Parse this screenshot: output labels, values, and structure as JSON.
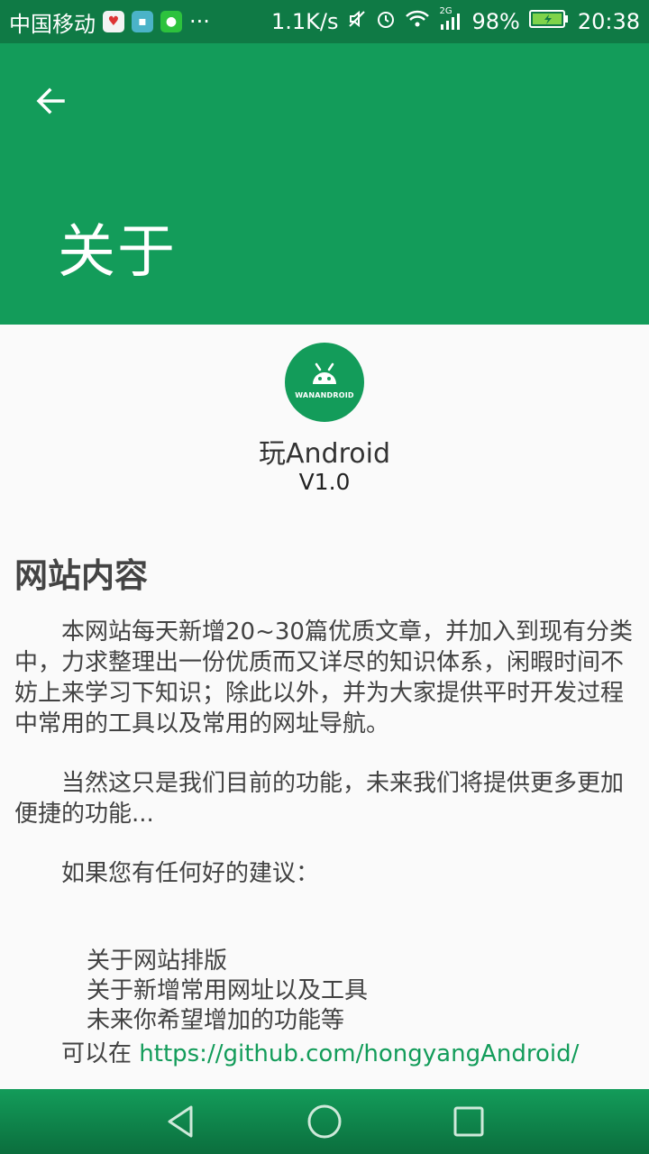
{
  "status": {
    "carrier": "中国移动",
    "more": "···",
    "speed": "1.1K/s",
    "network": "2G",
    "battery": "98%",
    "time": "20:38"
  },
  "appbar": {
    "title": "关于"
  },
  "about": {
    "logo_text": "WANANDROID",
    "app_name": "玩Android",
    "version": "V1.0"
  },
  "section": {
    "heading": "网站内容",
    "para1": "　　本网站每天新增20~30篇优质文章，并加入到现有分类中，力求整理出一份优质而又详尽的知识体系，闲暇时间不妨上来学习下知识；除此以外，并为大家提供平时开发过程中常用的工具以及常用的网址导航。",
    "para2": "　　当然这只是我们目前的功能，未来我们将提供更多更加便捷的功能...",
    "para3": "　　如果您有任何好的建议：",
    "items": [
      "关于网站排版",
      "关于新增常用网址以及工具",
      "未来你希望增加的功能等"
    ],
    "para4_prefix": "　　可以在 ",
    "link": "https://github.com/hongyangAndroid/"
  },
  "colors": {
    "primary": "#139c5a",
    "status_bar": "#0f7a45",
    "link": "#139c5a"
  }
}
